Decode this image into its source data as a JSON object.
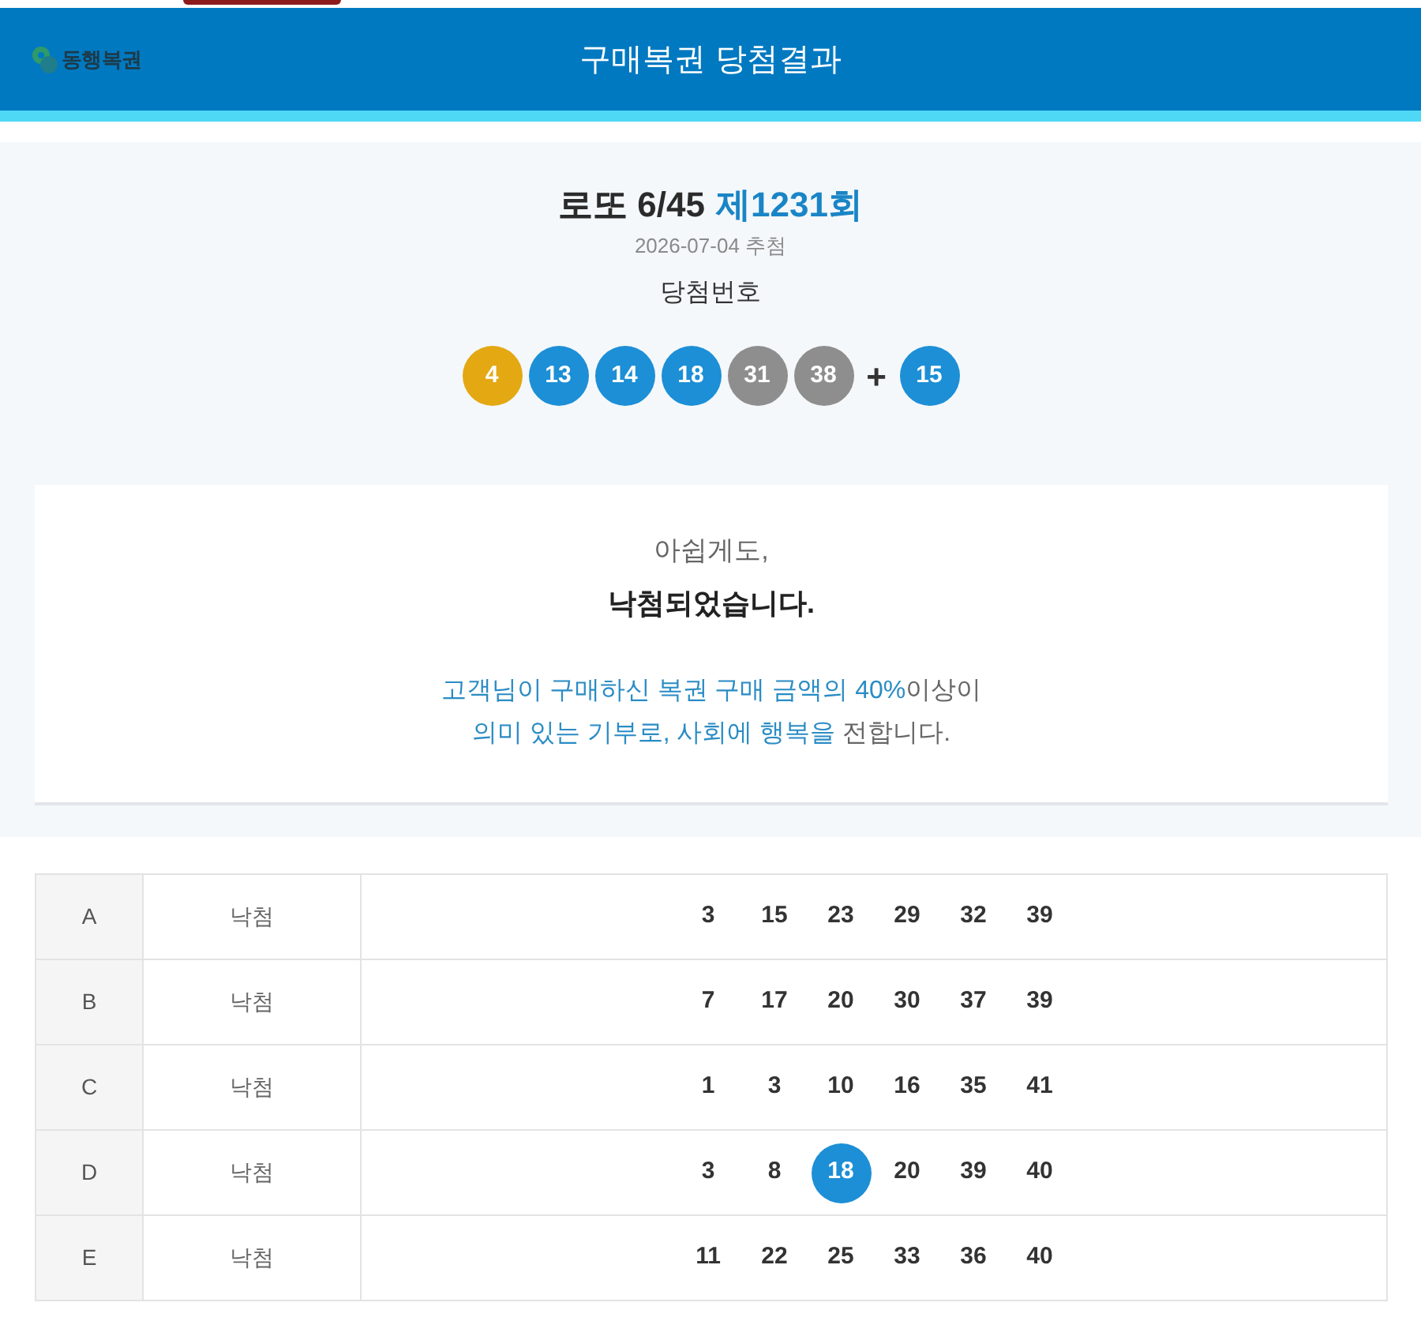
{
  "header": {
    "logo_text": "동행복권",
    "title": "구매복권 당첨결과"
  },
  "draw": {
    "game": "로또 6/45",
    "round": "제1231회",
    "date": "2026-07-04 추첨",
    "numbers_label": "당첨번호",
    "balls": [
      {
        "number": "4",
        "color": "#e3a812"
      },
      {
        "number": "13",
        "color": "#1c8fd6"
      },
      {
        "number": "14",
        "color": "#1c8fd6"
      },
      {
        "number": "18",
        "color": "#1c8fd6"
      },
      {
        "number": "31",
        "color": "#8e8e8e"
      },
      {
        "number": "38",
        "color": "#8e8e8e"
      }
    ],
    "plus": "+",
    "bonus": {
      "number": "15",
      "color": "#1c8fd6"
    }
  },
  "result": {
    "lead": "아쉽게도,",
    "status": "낙첨되었습니다.",
    "message": [
      [
        {
          "text": "고객님이 구매하신 복권 구매 금액의 40%",
          "highlight": true
        },
        {
          "text": "이상이",
          "highlight": false
        }
      ],
      [
        {
          "text": "의미 있는 기부로, 사회에 행복을",
          "highlight": true
        },
        {
          "text": " 전합니다.",
          "highlight": false
        }
      ]
    ]
  },
  "tickets": [
    {
      "line": "A",
      "result": "낙첨",
      "numbers": [
        {
          "number": "3",
          "matched": false
        },
        {
          "number": "15",
          "matched": false
        },
        {
          "number": "23",
          "matched": false
        },
        {
          "number": "29",
          "matched": false
        },
        {
          "number": "32",
          "matched": false
        },
        {
          "number": "39",
          "matched": false
        }
      ]
    },
    {
      "line": "B",
      "result": "낙첨",
      "numbers": [
        {
          "number": "7",
          "matched": false
        },
        {
          "number": "17",
          "matched": false
        },
        {
          "number": "20",
          "matched": false
        },
        {
          "number": "30",
          "matched": false
        },
        {
          "number": "37",
          "matched": false
        },
        {
          "number": "39",
          "matched": false
        }
      ]
    },
    {
      "line": "C",
      "result": "낙첨",
      "numbers": [
        {
          "number": "1",
          "matched": false
        },
        {
          "number": "3",
          "matched": false
        },
        {
          "number": "10",
          "matched": false
        },
        {
          "number": "16",
          "matched": false
        },
        {
          "number": "35",
          "matched": false
        },
        {
          "number": "41",
          "matched": false
        }
      ]
    },
    {
      "line": "D",
      "result": "낙첨",
      "numbers": [
        {
          "number": "3",
          "matched": false
        },
        {
          "number": "8",
          "matched": false
        },
        {
          "number": "18",
          "matched": true
        },
        {
          "number": "20",
          "matched": false
        },
        {
          "number": "39",
          "matched": false
        },
        {
          "number": "40",
          "matched": false
        }
      ]
    },
    {
      "line": "E",
      "result": "낙첨",
      "numbers": [
        {
          "number": "11",
          "matched": false
        },
        {
          "number": "22",
          "matched": false
        },
        {
          "number": "25",
          "matched": false
        },
        {
          "number": "33",
          "matched": false
        },
        {
          "number": "36",
          "matched": false
        },
        {
          "number": "40",
          "matched": false
        }
      ]
    }
  ]
}
